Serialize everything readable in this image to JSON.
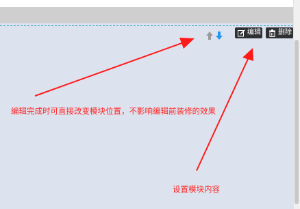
{
  "toolbar": {
    "edit_label": "编辑",
    "delete_label": "删除",
    "move_up_icon": "arrow-up-icon",
    "move_down_icon": "arrow-down-icon"
  },
  "annotations": {
    "move_note": "编辑完成时可直接改变模块位置，不影响编辑前装修的效果",
    "settings_note": "设置模块内容"
  },
  "colors": {
    "annotation": "#ff2222",
    "module_background": "#dde3ee",
    "button_background": "#2f3033",
    "up_arrow": "#9a9a9a",
    "down_arrow": "#2196f3"
  }
}
